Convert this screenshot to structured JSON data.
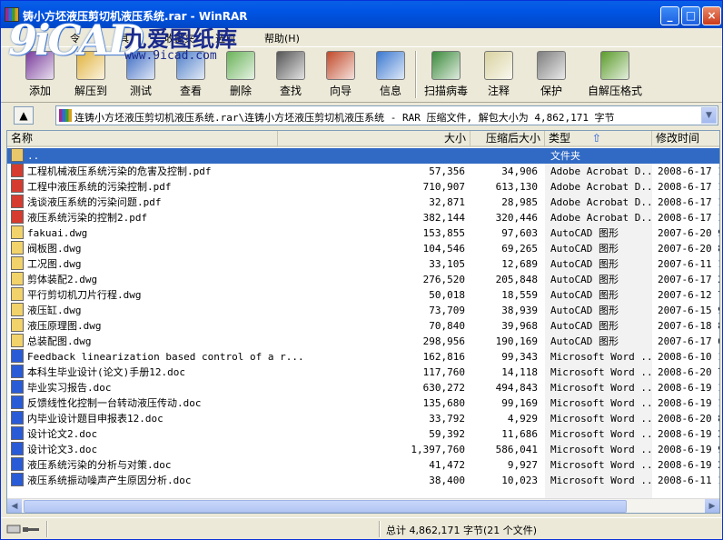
{
  "window": {
    "title": "铸小方坯液压剪切机液压系统.rar - WinRAR"
  },
  "watermark": {
    "logo": "9iCAD",
    "cn": "九爱图纸库",
    "url": "www.9icad.com"
  },
  "menu": [
    "令",
    "具",
    "收藏夹",
    "选项",
    "帮助(H)"
  ],
  "toolbar": [
    {
      "label": "添加",
      "icon": "books-add-icon",
      "color": "#7a3c9c"
    },
    {
      "label": "解压到",
      "icon": "folder-extract-icon",
      "color": "#e1b33c"
    },
    {
      "label": "测试",
      "icon": "checkmark-test-icon",
      "color": "#3d6cc4"
    },
    {
      "label": "查看",
      "icon": "book-view-icon",
      "color": "#4f7fc9"
    },
    {
      "label": "删除",
      "icon": "recycle-bin-icon",
      "color": "#6ab35a"
    },
    {
      "label": "查找",
      "icon": "binoculars-icon",
      "color": "#555555"
    },
    {
      "label": "向导",
      "icon": "wizard-icon",
      "color": "#c14a2a"
    },
    {
      "label": "信息",
      "icon": "info-icon",
      "color": "#3a78d0"
    },
    {
      "label": "扫描病毒",
      "icon": "virus-scan-icon",
      "color": "#3b8a3b"
    },
    {
      "label": "注释",
      "icon": "comment-icon",
      "color": "#d9d2a0"
    },
    {
      "label": "保护",
      "icon": "shield-protect-icon",
      "color": "#7e7e7e"
    },
    {
      "label": "自解压格式",
      "icon": "sfx-icon",
      "color": "#5c9c2c"
    }
  ],
  "address": {
    "text": "连铸小方坯液压剪切机液压系统.rar\\连铸小方坯液压剪切机液压系统 - RAR 压缩文件, 解包大小为 4,862,171 字节"
  },
  "columns": {
    "name": "名称",
    "size": "大小",
    "packed": "压缩后大小",
    "type": "类型",
    "modified": "修改时间"
  },
  "files": [
    {
      "name": "..",
      "size": "",
      "packed": "",
      "type": "文件夹",
      "modified": "",
      "kind": "folder"
    },
    {
      "name": "工程机械液压系统污染的危害及控制.pdf",
      "size": "57,356",
      "packed": "34,906",
      "type": "Adobe Acrobat D...",
      "modified": "2008-6-17 1",
      "kind": "pdf"
    },
    {
      "name": "工程中液压系统的污染控制.pdf",
      "size": "710,907",
      "packed": "613,130",
      "type": "Adobe Acrobat D...",
      "modified": "2008-6-17 1",
      "kind": "pdf"
    },
    {
      "name": "浅谈液压系统的污染问题.pdf",
      "size": "32,871",
      "packed": "28,985",
      "type": "Adobe Acrobat D...",
      "modified": "2008-6-17 1",
      "kind": "pdf"
    },
    {
      "name": "液压系统污染的控制2.pdf",
      "size": "382,144",
      "packed": "320,446",
      "type": "Adobe Acrobat D...",
      "modified": "2008-6-17 1",
      "kind": "pdf"
    },
    {
      "name": "fakuai.dwg",
      "size": "153,855",
      "packed": "97,603",
      "type": "AutoCAD 图形",
      "modified": "2007-6-20 9",
      "kind": "dwg"
    },
    {
      "name": "阀板图.dwg",
      "size": "104,546",
      "packed": "69,265",
      "type": "AutoCAD 图形",
      "modified": "2007-6-20 8",
      "kind": "dwg"
    },
    {
      "name": "工况图.dwg",
      "size": "33,105",
      "packed": "12,689",
      "type": "AutoCAD 图形",
      "modified": "2007-6-11 1",
      "kind": "dwg"
    },
    {
      "name": "剪体装配2.dwg",
      "size": "276,520",
      "packed": "205,848",
      "type": "AutoCAD 图形",
      "modified": "2007-6-17 2",
      "kind": "dwg"
    },
    {
      "name": "平行剪切机刀片行程.dwg",
      "size": "50,018",
      "packed": "18,559",
      "type": "AutoCAD 图形",
      "modified": "2007-6-12 7",
      "kind": "dwg"
    },
    {
      "name": "液压缸.dwg",
      "size": "73,709",
      "packed": "38,939",
      "type": "AutoCAD 图形",
      "modified": "2007-6-15 9",
      "kind": "dwg"
    },
    {
      "name": "液压原理图.dwg",
      "size": "70,840",
      "packed": "39,968",
      "type": "AutoCAD 图形",
      "modified": "2007-6-18 8",
      "kind": "dwg"
    },
    {
      "name": "总装配图.dwg",
      "size": "298,956",
      "packed": "190,169",
      "type": "AutoCAD 图形",
      "modified": "2007-6-17 6",
      "kind": "dwg"
    },
    {
      "name": "Feedback linearization based control of a r...",
      "size": "162,816",
      "packed": "99,343",
      "type": "Microsoft Word ...",
      "modified": "2008-6-10 1",
      "kind": "doc"
    },
    {
      "name": "本科生毕业设计(论文)手册12.doc",
      "size": "117,760",
      "packed": "14,118",
      "type": "Microsoft Word ...",
      "modified": "2008-6-20 7",
      "kind": "doc"
    },
    {
      "name": "毕业实习报告.doc",
      "size": "630,272",
      "packed": "494,843",
      "type": "Microsoft Word ...",
      "modified": "2008-6-19 1",
      "kind": "doc"
    },
    {
      "name": "反馈线性化控制一台转动液压传动.doc",
      "size": "135,680",
      "packed": "99,169",
      "type": "Microsoft Word ...",
      "modified": "2008-6-19 1",
      "kind": "doc"
    },
    {
      "name": "内毕业设计题目申报表12.doc",
      "size": "33,792",
      "packed": "4,929",
      "type": "Microsoft Word ...",
      "modified": "2008-6-20 8",
      "kind": "doc"
    },
    {
      "name": "设计论文2.doc",
      "size": "59,392",
      "packed": "11,686",
      "type": "Microsoft Word ...",
      "modified": "2008-6-19 2",
      "kind": "doc"
    },
    {
      "name": "设计论文3.doc",
      "size": "1,397,760",
      "packed": "586,041",
      "type": "Microsoft Word ...",
      "modified": "2008-6-19 9",
      "kind": "doc"
    },
    {
      "name": "液压系统污染的分析与对策.doc",
      "size": "41,472",
      "packed": "9,927",
      "type": "Microsoft Word ...",
      "modified": "2008-6-19 2",
      "kind": "doc"
    },
    {
      "name": "液压系统振动噪声产生原因分析.doc",
      "size": "38,400",
      "packed": "10,023",
      "type": "Microsoft Word ...",
      "modified": "2008-6-11 1",
      "kind": "doc"
    }
  ],
  "status": {
    "text": "总计 4,862,171 字节(21 个文件)"
  }
}
